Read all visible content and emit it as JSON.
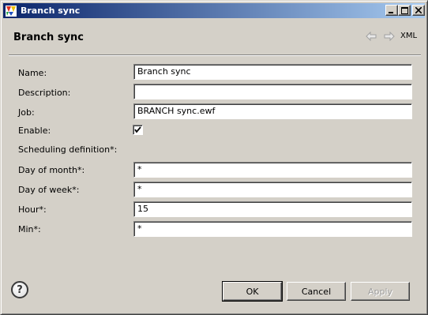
{
  "window": {
    "title": "Branch sync",
    "icon": "app-icon",
    "controls": [
      "minimize-icon",
      "maximize-icon",
      "close-icon"
    ]
  },
  "header": {
    "title": "Branch sync",
    "back_icon": "arrow-left-icon",
    "forward_icon": "arrow-right-icon",
    "xml_label": "XML"
  },
  "form": {
    "name": {
      "label": "Name:",
      "value": "Branch sync"
    },
    "description": {
      "label": "Description:",
      "value": ""
    },
    "job": {
      "label": "Job:",
      "value": "BRANCH sync.ewf"
    },
    "enable": {
      "label": "Enable:",
      "checked": true
    },
    "scheduling": {
      "label": "Scheduling definition*:"
    },
    "day_of_month": {
      "label": "Day of month*:",
      "value": "*"
    },
    "day_of_week": {
      "label": "Day of week*:",
      "value": "*"
    },
    "hour": {
      "label": "Hour*:",
      "value": "15"
    },
    "min": {
      "label": "Min*:",
      "value": "*"
    }
  },
  "footer": {
    "help_icon": "help-icon",
    "ok_label": "OK",
    "cancel_label": "Cancel",
    "apply_label": "Apply"
  },
  "colors": {
    "titlebar_start": "#0a246a",
    "titlebar_end": "#a6caf0",
    "dialog_bg": "#d4d0c8"
  }
}
